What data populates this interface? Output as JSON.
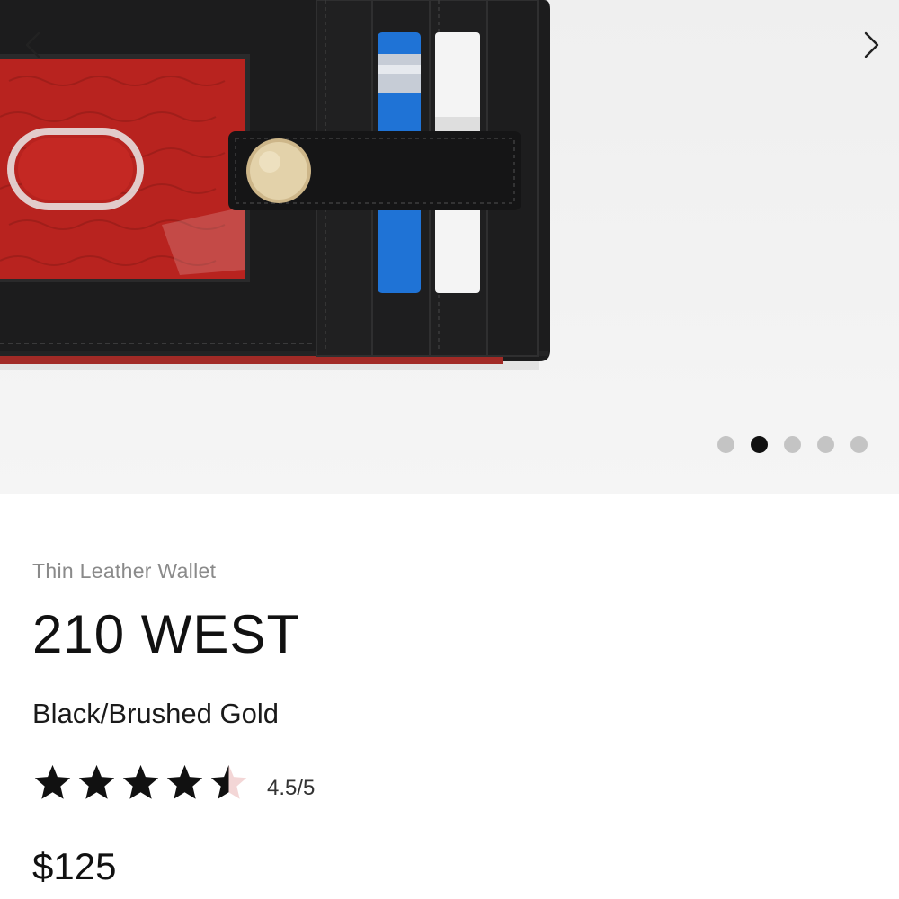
{
  "carousel": {
    "prev_icon": "chevron-left-icon",
    "next_icon": "chevron-right-icon",
    "slide_count": 5,
    "active_slide": 2,
    "image_subject": "wallet-photo"
  },
  "product": {
    "category": "Thin Leather Wallet",
    "name": "210 WEST",
    "variant": "Black/Brushed Gold",
    "rating": {
      "value": 4.5,
      "max": 5,
      "label": "4.5/5"
    },
    "price": "$125"
  },
  "colors": {
    "text_primary": "#111111",
    "text_muted": "#8a8a8a",
    "dot_inactive": "#c4c4c4",
    "dot_active": "#111111",
    "star": "#111111",
    "star_empty": "#f3d6d6"
  }
}
